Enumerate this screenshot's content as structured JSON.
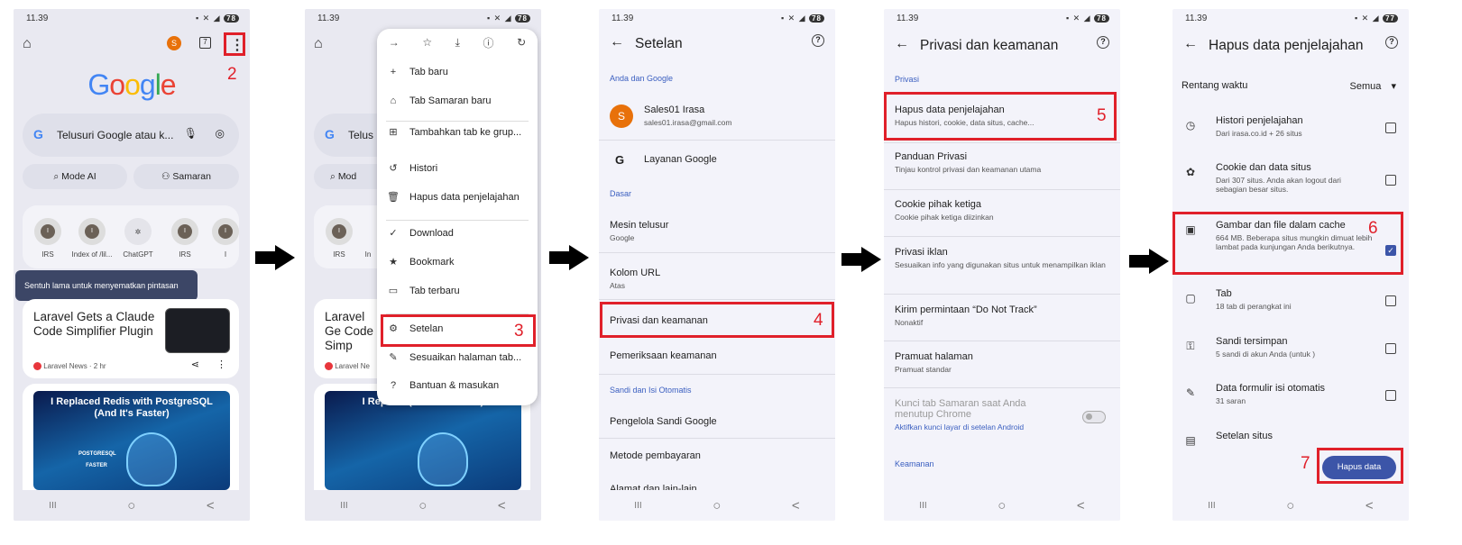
{
  "status": {
    "time": "11.39",
    "battery": [
      "78",
      "78",
      "78",
      "78",
      "77"
    ]
  },
  "nav": {
    "recents": "III",
    "home": "○",
    "back": "<"
  },
  "steps": [
    "2",
    "3",
    "4",
    "5",
    "6",
    "7"
  ],
  "panel1": {
    "tab_count": "7",
    "avatar": "S",
    "logo": [
      "G",
      "o",
      "o",
      "g",
      "l",
      "e"
    ],
    "logo_colors": [
      "#4285F4",
      "#EA4335",
      "#FBBC05",
      "#4285F4",
      "#34A853",
      "#EA4335"
    ],
    "search_placeholder": "Telusuri Google atau k...",
    "mode_ai": "Mode AI",
    "incognito": "Samaran",
    "shortcuts": [
      "IRS",
      "Index of /lil...",
      "ChatGPT",
      "IRS",
      "I"
    ],
    "tooltip": "Sentuh lama untuk menyematkan pintasan",
    "card1_title": "Laravel Gets a Claude Code Simplifier Plugin",
    "card1_source": "Laravel News · 2 hr",
    "card2_title": "I Replaced Redis with PostgreSQL (And It's Faster)",
    "card2_img_label": "POSTGRESQL FASTER"
  },
  "panel2": {
    "search_placeholder": "Telus",
    "mode_ai": "Mod",
    "shortcuts": [
      "IRS",
      "In"
    ],
    "card1_title": "Laravel Ge Code Simp",
    "card1_source": "Laravel Ne",
    "card2_title": "I Replace (And It's Faster)",
    "menu": [
      {
        "icon": "+",
        "label": "Tab baru"
      },
      {
        "icon": "⌂",
        "label": "Tab Samaran baru"
      },
      {
        "icon": "⊞",
        "label": "Tambahkan tab ke grup..."
      },
      {
        "icon": "↺",
        "label": "Histori"
      },
      {
        "icon": "🗑",
        "label": "Hapus data penjelajahan"
      },
      {
        "icon": "✓",
        "label": "Download"
      },
      {
        "icon": "★",
        "label": "Bookmark"
      },
      {
        "icon": "▭",
        "label": "Tab terbaru"
      },
      {
        "icon": "⚙",
        "label": "Setelan"
      },
      {
        "icon": "✎",
        "label": "Sesuaikan halaman tab..."
      },
      {
        "icon": "?",
        "label": "Bantuan & masukan"
      }
    ]
  },
  "panel3": {
    "title": "Setelan",
    "section_you": "Anda dan Google",
    "account_name": "Sales01 Irasa",
    "account_email": "sales01.irasa@gmail.com",
    "google_services": "Layanan Google",
    "section_basic": "Dasar",
    "search_engine": "Mesin telusur",
    "search_engine_value": "Google",
    "url_bar": "Kolom URL",
    "url_bar_value": "Atas",
    "privacy": "Privasi dan keamanan",
    "safety_check": "Pemeriksaan keamanan",
    "section_autofill": "Sandi dan Isi Otomatis",
    "password_manager": "Pengelola Sandi Google",
    "payment": "Metode pembayaran",
    "addresses": "Alamat dan lain-lain"
  },
  "panel4": {
    "title": "Privasi dan keamanan",
    "section_privacy": "Privasi",
    "items": [
      {
        "t": "Hapus data penjelajahan",
        "s": "Hapus histori, cookie, data situs, cache..."
      },
      {
        "t": "Panduan Privasi",
        "s": "Tinjau kontrol privasi dan keamanan utama"
      },
      {
        "t": "Cookie pihak ketiga",
        "s": "Cookie pihak ketiga diizinkan"
      },
      {
        "t": "Privasi iklan",
        "s": "Sesuaikan info yang digunakan situs untuk menampilkan iklan"
      },
      {
        "t": "Kirim permintaan “Do Not Track”",
        "s": "Nonaktif"
      },
      {
        "t": "Pramuat halaman",
        "s": "Pramuat standar"
      },
      {
        "t": "Kunci tab Samaran saat Anda menutup Chrome",
        "s": "Aktifkan kunci layar di setelan Android"
      }
    ],
    "section_security": "Keamanan"
  },
  "panel5": {
    "title": "Hapus data penjelajahan",
    "time_range_label": "Rentang waktu",
    "time_range_value": "Semua",
    "items": [
      {
        "t": "Histori penjelajahan",
        "s": "Dari irasa.co.id + 26 situs",
        "checked": false
      },
      {
        "t": "Cookie dan data situs",
        "s": "Dari 307 situs. Anda akan logout dari sebagian besar situs.",
        "checked": false
      },
      {
        "t": "Gambar dan file dalam cache",
        "s": "664 MB. Beberapa situs mungkin dimuat lebih lambat pada kunjungan Anda berikutnya.",
        "checked": true
      },
      {
        "t": "Tab",
        "s": "18 tab di perangkat ini",
        "checked": false
      },
      {
        "t": "Sandi tersimpan",
        "s": "5 sandi di akun Anda (untuk )",
        "checked": false
      },
      {
        "t": "Data formulir isi otomatis",
        "s": "31 saran",
        "checked": false
      },
      {
        "t": "Setelan situs",
        "s": "",
        "checked": false
      }
    ],
    "clear_button": "Hapus data"
  }
}
